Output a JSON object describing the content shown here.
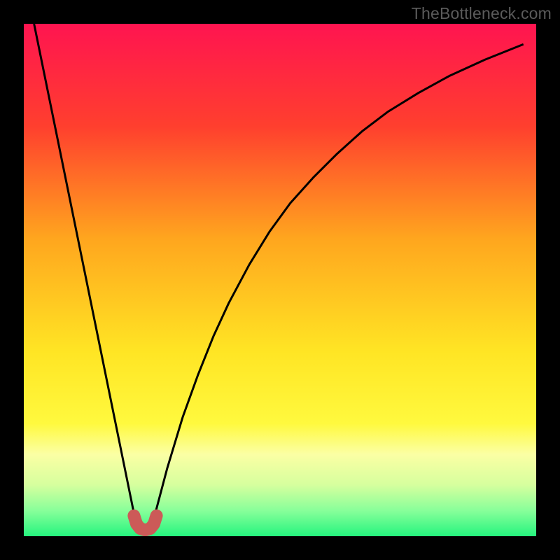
{
  "watermark": "TheBottleneck.com",
  "chart_data": {
    "type": "line",
    "title": "",
    "xlabel": "",
    "ylabel": "",
    "xlim": [
      0,
      1
    ],
    "ylim": [
      0,
      1
    ],
    "background_gradient": {
      "stops": [
        {
          "offset": 0.0,
          "color": "#ff1450"
        },
        {
          "offset": 0.2,
          "color": "#ff3f2e"
        },
        {
          "offset": 0.42,
          "color": "#ffa61e"
        },
        {
          "offset": 0.64,
          "color": "#ffe524"
        },
        {
          "offset": 0.78,
          "color": "#fff93e"
        },
        {
          "offset": 0.84,
          "color": "#fbffa4"
        },
        {
          "offset": 0.9,
          "color": "#d6ff9e"
        },
        {
          "offset": 0.95,
          "color": "#88ff9a"
        },
        {
          "offset": 1.0,
          "color": "#25f47e"
        }
      ]
    },
    "series": [
      {
        "name": "left-curve",
        "color": "#000000",
        "stroke_width": 3,
        "x": [
          0.02,
          0.04,
          0.06,
          0.08,
          0.1,
          0.12,
          0.14,
          0.16,
          0.18,
          0.2,
          0.22
        ],
        "y": [
          1.0,
          0.902,
          0.804,
          0.706,
          0.608,
          0.51,
          0.412,
          0.314,
          0.216,
          0.118,
          0.02
        ]
      },
      {
        "name": "right-curve",
        "color": "#000000",
        "stroke_width": 3,
        "x": [
          0.25,
          0.28,
          0.31,
          0.34,
          0.37,
          0.4,
          0.44,
          0.48,
          0.52,
          0.565,
          0.61,
          0.66,
          0.71,
          0.77,
          0.83,
          0.9,
          0.975
        ],
        "y": [
          0.02,
          0.133,
          0.232,
          0.315,
          0.39,
          0.455,
          0.53,
          0.595,
          0.65,
          0.7,
          0.745,
          0.79,
          0.828,
          0.865,
          0.898,
          0.93,
          0.96
        ]
      },
      {
        "name": "valley-marker",
        "color": "#cc5a58",
        "stroke_width": 18,
        "linecap": "round",
        "x": [
          0.215,
          0.22,
          0.227,
          0.237,
          0.247,
          0.254,
          0.259
        ],
        "y": [
          0.04,
          0.024,
          0.015,
          0.012,
          0.015,
          0.024,
          0.04
        ]
      }
    ]
  }
}
